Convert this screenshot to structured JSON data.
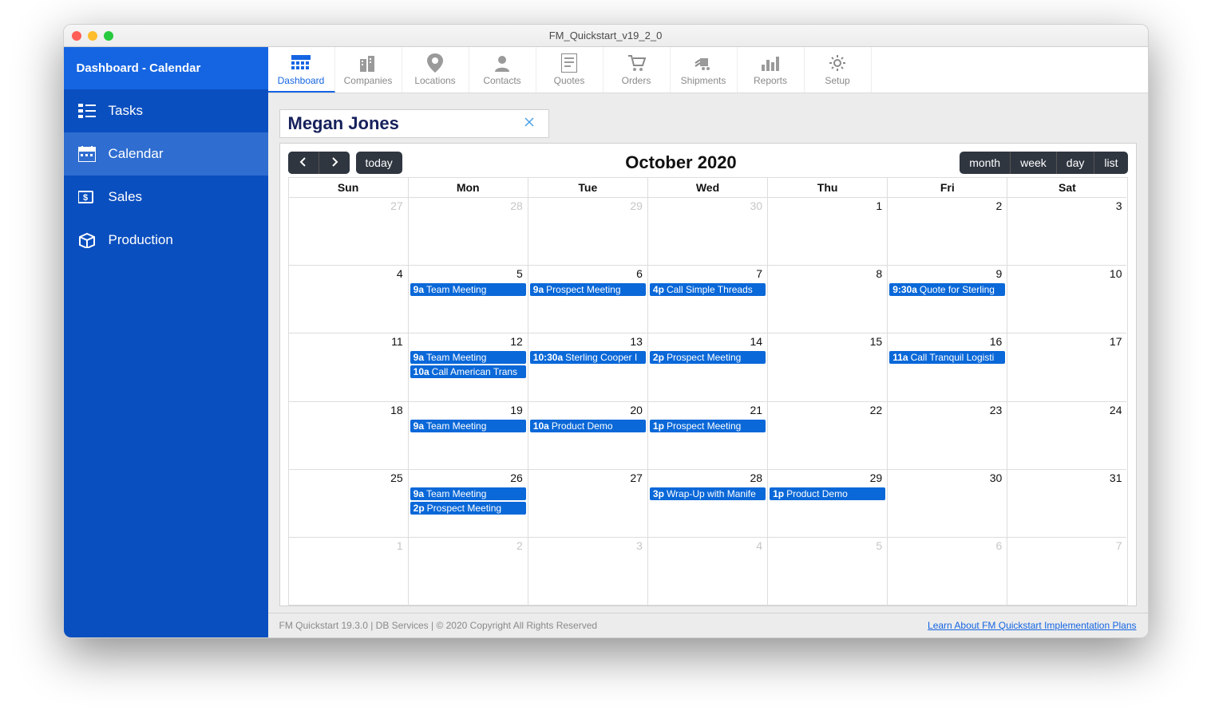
{
  "window_title": "FM_Quickstart_v19_2_0",
  "sidebar": {
    "header": "Dashboard - Calendar",
    "items": [
      {
        "label": "Tasks",
        "icon": "tasks"
      },
      {
        "label": "Calendar",
        "icon": "calendar",
        "active": true
      },
      {
        "label": "Sales",
        "icon": "sales"
      },
      {
        "label": "Production",
        "icon": "production"
      }
    ]
  },
  "topnav": [
    {
      "label": "Dashboard",
      "icon": "dashboard",
      "active": true
    },
    {
      "label": "Companies",
      "icon": "companies"
    },
    {
      "label": "Locations",
      "icon": "locations"
    },
    {
      "label": "Contacts",
      "icon": "contacts"
    },
    {
      "label": "Quotes",
      "icon": "quotes"
    },
    {
      "label": "Orders",
      "icon": "orders"
    },
    {
      "label": "Shipments",
      "icon": "shipments"
    },
    {
      "label": "Reports",
      "icon": "reports"
    },
    {
      "label": "Setup",
      "icon": "setup"
    }
  ],
  "person_name": "Megan Jones",
  "calendar": {
    "title": "October 2020",
    "today_label": "today",
    "views": [
      "month",
      "week",
      "day",
      "list"
    ],
    "day_headers": [
      "Sun",
      "Mon",
      "Tue",
      "Wed",
      "Thu",
      "Fri",
      "Sat"
    ],
    "weeks": [
      [
        {
          "num": "27",
          "other": true,
          "events": []
        },
        {
          "num": "28",
          "other": true,
          "events": []
        },
        {
          "num": "29",
          "other": true,
          "events": []
        },
        {
          "num": "30",
          "other": true,
          "events": []
        },
        {
          "num": "1",
          "events": []
        },
        {
          "num": "2",
          "events": []
        },
        {
          "num": "3",
          "events": []
        }
      ],
      [
        {
          "num": "4",
          "events": []
        },
        {
          "num": "5",
          "events": [
            {
              "time": "9a",
              "title": "Team Meeting"
            }
          ]
        },
        {
          "num": "6",
          "events": [
            {
              "time": "9a",
              "title": "Prospect Meeting"
            }
          ]
        },
        {
          "num": "7",
          "events": [
            {
              "time": "4p",
              "title": "Call Simple Threads"
            }
          ]
        },
        {
          "num": "8",
          "events": []
        },
        {
          "num": "9",
          "events": [
            {
              "time": "9:30a",
              "title": "Quote for Sterling"
            }
          ]
        },
        {
          "num": "10",
          "events": []
        }
      ],
      [
        {
          "num": "11",
          "events": []
        },
        {
          "num": "12",
          "events": [
            {
              "time": "9a",
              "title": "Team Meeting"
            },
            {
              "time": "10a",
              "title": "Call American Trans"
            }
          ]
        },
        {
          "num": "13",
          "events": [
            {
              "time": "10:30a",
              "title": "Sterling Cooper I"
            }
          ]
        },
        {
          "num": "14",
          "events": [
            {
              "time": "2p",
              "title": "Prospect Meeting"
            }
          ]
        },
        {
          "num": "15",
          "events": []
        },
        {
          "num": "16",
          "events": [
            {
              "time": "11a",
              "title": "Call Tranquil Logisti"
            }
          ]
        },
        {
          "num": "17",
          "events": []
        }
      ],
      [
        {
          "num": "18",
          "events": []
        },
        {
          "num": "19",
          "events": [
            {
              "time": "9a",
              "title": "Team Meeting"
            }
          ]
        },
        {
          "num": "20",
          "events": [
            {
              "time": "10a",
              "title": "Product Demo"
            }
          ]
        },
        {
          "num": "21",
          "events": [
            {
              "time": "1p",
              "title": "Prospect Meeting"
            }
          ]
        },
        {
          "num": "22",
          "events": []
        },
        {
          "num": "23",
          "events": []
        },
        {
          "num": "24",
          "events": []
        }
      ],
      [
        {
          "num": "25",
          "events": []
        },
        {
          "num": "26",
          "events": [
            {
              "time": "9a",
              "title": "Team Meeting"
            },
            {
              "time": "2p",
              "title": "Prospect Meeting"
            }
          ]
        },
        {
          "num": "27",
          "events": []
        },
        {
          "num": "28",
          "events": [
            {
              "time": "3p",
              "title": "Wrap-Up with Manife"
            }
          ]
        },
        {
          "num": "29",
          "events": [
            {
              "time": "1p",
              "title": "Product Demo"
            }
          ]
        },
        {
          "num": "30",
          "events": []
        },
        {
          "num": "31",
          "events": []
        }
      ],
      [
        {
          "num": "1",
          "other": true,
          "events": []
        },
        {
          "num": "2",
          "other": true,
          "events": []
        },
        {
          "num": "3",
          "other": true,
          "events": []
        },
        {
          "num": "4",
          "other": true,
          "events": []
        },
        {
          "num": "5",
          "other": true,
          "events": []
        },
        {
          "num": "6",
          "other": true,
          "events": []
        },
        {
          "num": "7",
          "other": true,
          "events": []
        }
      ]
    ]
  },
  "footer": {
    "left": "FM Quickstart 19.3.0  |  DB Services  |  © 2020 Copyright All Rights Reserved",
    "link": "Learn About FM Quickstart Implementation Plans"
  }
}
